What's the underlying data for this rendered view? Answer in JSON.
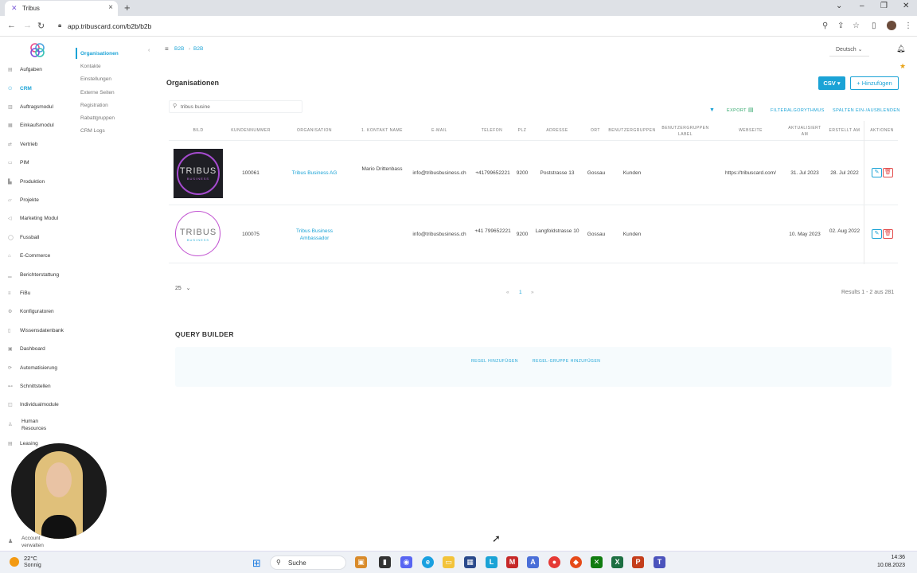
{
  "browser": {
    "tab_title": "Tribus",
    "url": "app.tribuscard.com/b2b/b2b",
    "new_tab": "+",
    "tab_close": "×"
  },
  "sidebar": {
    "items": [
      {
        "label": "Aufgaben",
        "icon": "tasks-icon"
      },
      {
        "label": "CRM",
        "icon": "users-icon",
        "active": true
      },
      {
        "label": "Auftragsmodul",
        "icon": "order-icon"
      },
      {
        "label": "Einkaufsmodul",
        "icon": "cart-icon"
      },
      {
        "label": "Vertrieb",
        "icon": "sales-icon"
      },
      {
        "label": "PIM",
        "icon": "pim-icon"
      },
      {
        "label": "Produktion",
        "icon": "factory-icon"
      },
      {
        "label": "Projekte",
        "icon": "project-icon"
      },
      {
        "label": "Marketing Modul",
        "icon": "marketing-icon"
      },
      {
        "label": "Fussball",
        "icon": "ball-icon"
      },
      {
        "label": "E-Commerce",
        "icon": "shop-icon"
      },
      {
        "label": "Berichterstattung",
        "icon": "report-icon"
      },
      {
        "label": "FiBu",
        "icon": "finance-icon"
      },
      {
        "label": "Konfiguratoren",
        "icon": "config-icon"
      },
      {
        "label": "Wissensdatenbank",
        "icon": "book-icon"
      },
      {
        "label": "Dashboard",
        "icon": "dashboard-icon"
      },
      {
        "label": "Automatisierung",
        "icon": "automation-icon"
      },
      {
        "label": "Schnittstellen",
        "icon": "plug-icon"
      },
      {
        "label": "Individualmodule",
        "icon": "module-icon"
      },
      {
        "label": "Human Resources",
        "icon": "hr-icon"
      },
      {
        "label": "Leasing",
        "icon": "leasing-icon"
      }
    ],
    "account_label_1": "Account",
    "account_label_2": "verwalten"
  },
  "submenu": {
    "items": [
      {
        "label": "Organisationen",
        "active": true
      },
      {
        "label": "Kontakte"
      },
      {
        "label": "Einstellungen"
      },
      {
        "label": "Externe Seiten"
      },
      {
        "label": "Registration"
      },
      {
        "label": "Rabattgruppen"
      },
      {
        "label": "CRM Logs"
      }
    ]
  },
  "header": {
    "breadcrumb": [
      "B2B",
      "B2B"
    ],
    "language": "Deutsch",
    "page_title": "Organisationen",
    "csv_label": "CSV ▾",
    "add_label": "+ Hinzufügen"
  },
  "search": {
    "value": "tribus busine",
    "placeholder": ""
  },
  "toolbar": {
    "export": "EXPORT",
    "filter_algo": "FILTERALGORYTHMUS",
    "columns": "SPALTEN EIN-/AUSBLENDEN"
  },
  "table": {
    "headers": [
      "BILD",
      "KUNDENNUMMER",
      "ORGANISATION",
      "1. KONTAKT NAME",
      "E-MAIL",
      "TELEFON",
      "PLZ",
      "ADRESSE",
      "ORT",
      "BENUTZERGRUPPEN",
      "BENUTZERGRUPPEN LABEL",
      "WEBSEITE",
      "AKTUALISIERT AM",
      "ERSTELLT AM",
      "AKTIONEN"
    ],
    "rows": [
      {
        "kundennummer": "100061",
        "organisation": "Tribus Business AG",
        "kontakt": "Mario Drittenbass",
        "email": "info@tribusbusiness.ch",
        "telefon": "+41799652221",
        "plz": "9200",
        "adresse": "Poststrasse 13",
        "ort": "Gossau",
        "gruppe": "Kunden",
        "gruppe_label": "",
        "webseite": "https://tribuscard.com/",
        "aktualisiert": "31. Jul 2023",
        "erstellt": "28. Jul 2022",
        "logo_text_1": "TRIBUS",
        "logo_text_2": "BUSINESS"
      },
      {
        "kundennummer": "100075",
        "organisation": "Tribus Business Ambassador",
        "kontakt": "",
        "email": "info@tribusbusiness.ch",
        "telefon": "+41 799652221",
        "plz": "9200",
        "adresse": "Langfoldstrasse 10",
        "ort": "Gossau",
        "gruppe": "Kunden",
        "gruppe_label": "",
        "webseite": "",
        "aktualisiert": "10. May 2023",
        "erstellt": "02. Aug 2022",
        "logo_text_1": "TRIBUS",
        "logo_text_2": "BUSINESS"
      }
    ]
  },
  "pagination": {
    "page_size": "25",
    "prev": "«",
    "current": "1",
    "next": "»",
    "results": "Results 1 - 2 aus 281"
  },
  "query_builder": {
    "title": "QUERY BUILDER",
    "add_rule": "REGEL HINZUFÜGEN",
    "add_group": "REGEL-GRUPPE HINZUFÜGEN"
  },
  "taskbar": {
    "temperature": "22°C",
    "condition": "Sonnig",
    "search_label": "Suche",
    "time": "14:36",
    "date": "10.08.2023"
  },
  "colors": {
    "accent": "#1ba3d6",
    "danger": "#e24c4c",
    "export_green": "#2fa66a"
  }
}
